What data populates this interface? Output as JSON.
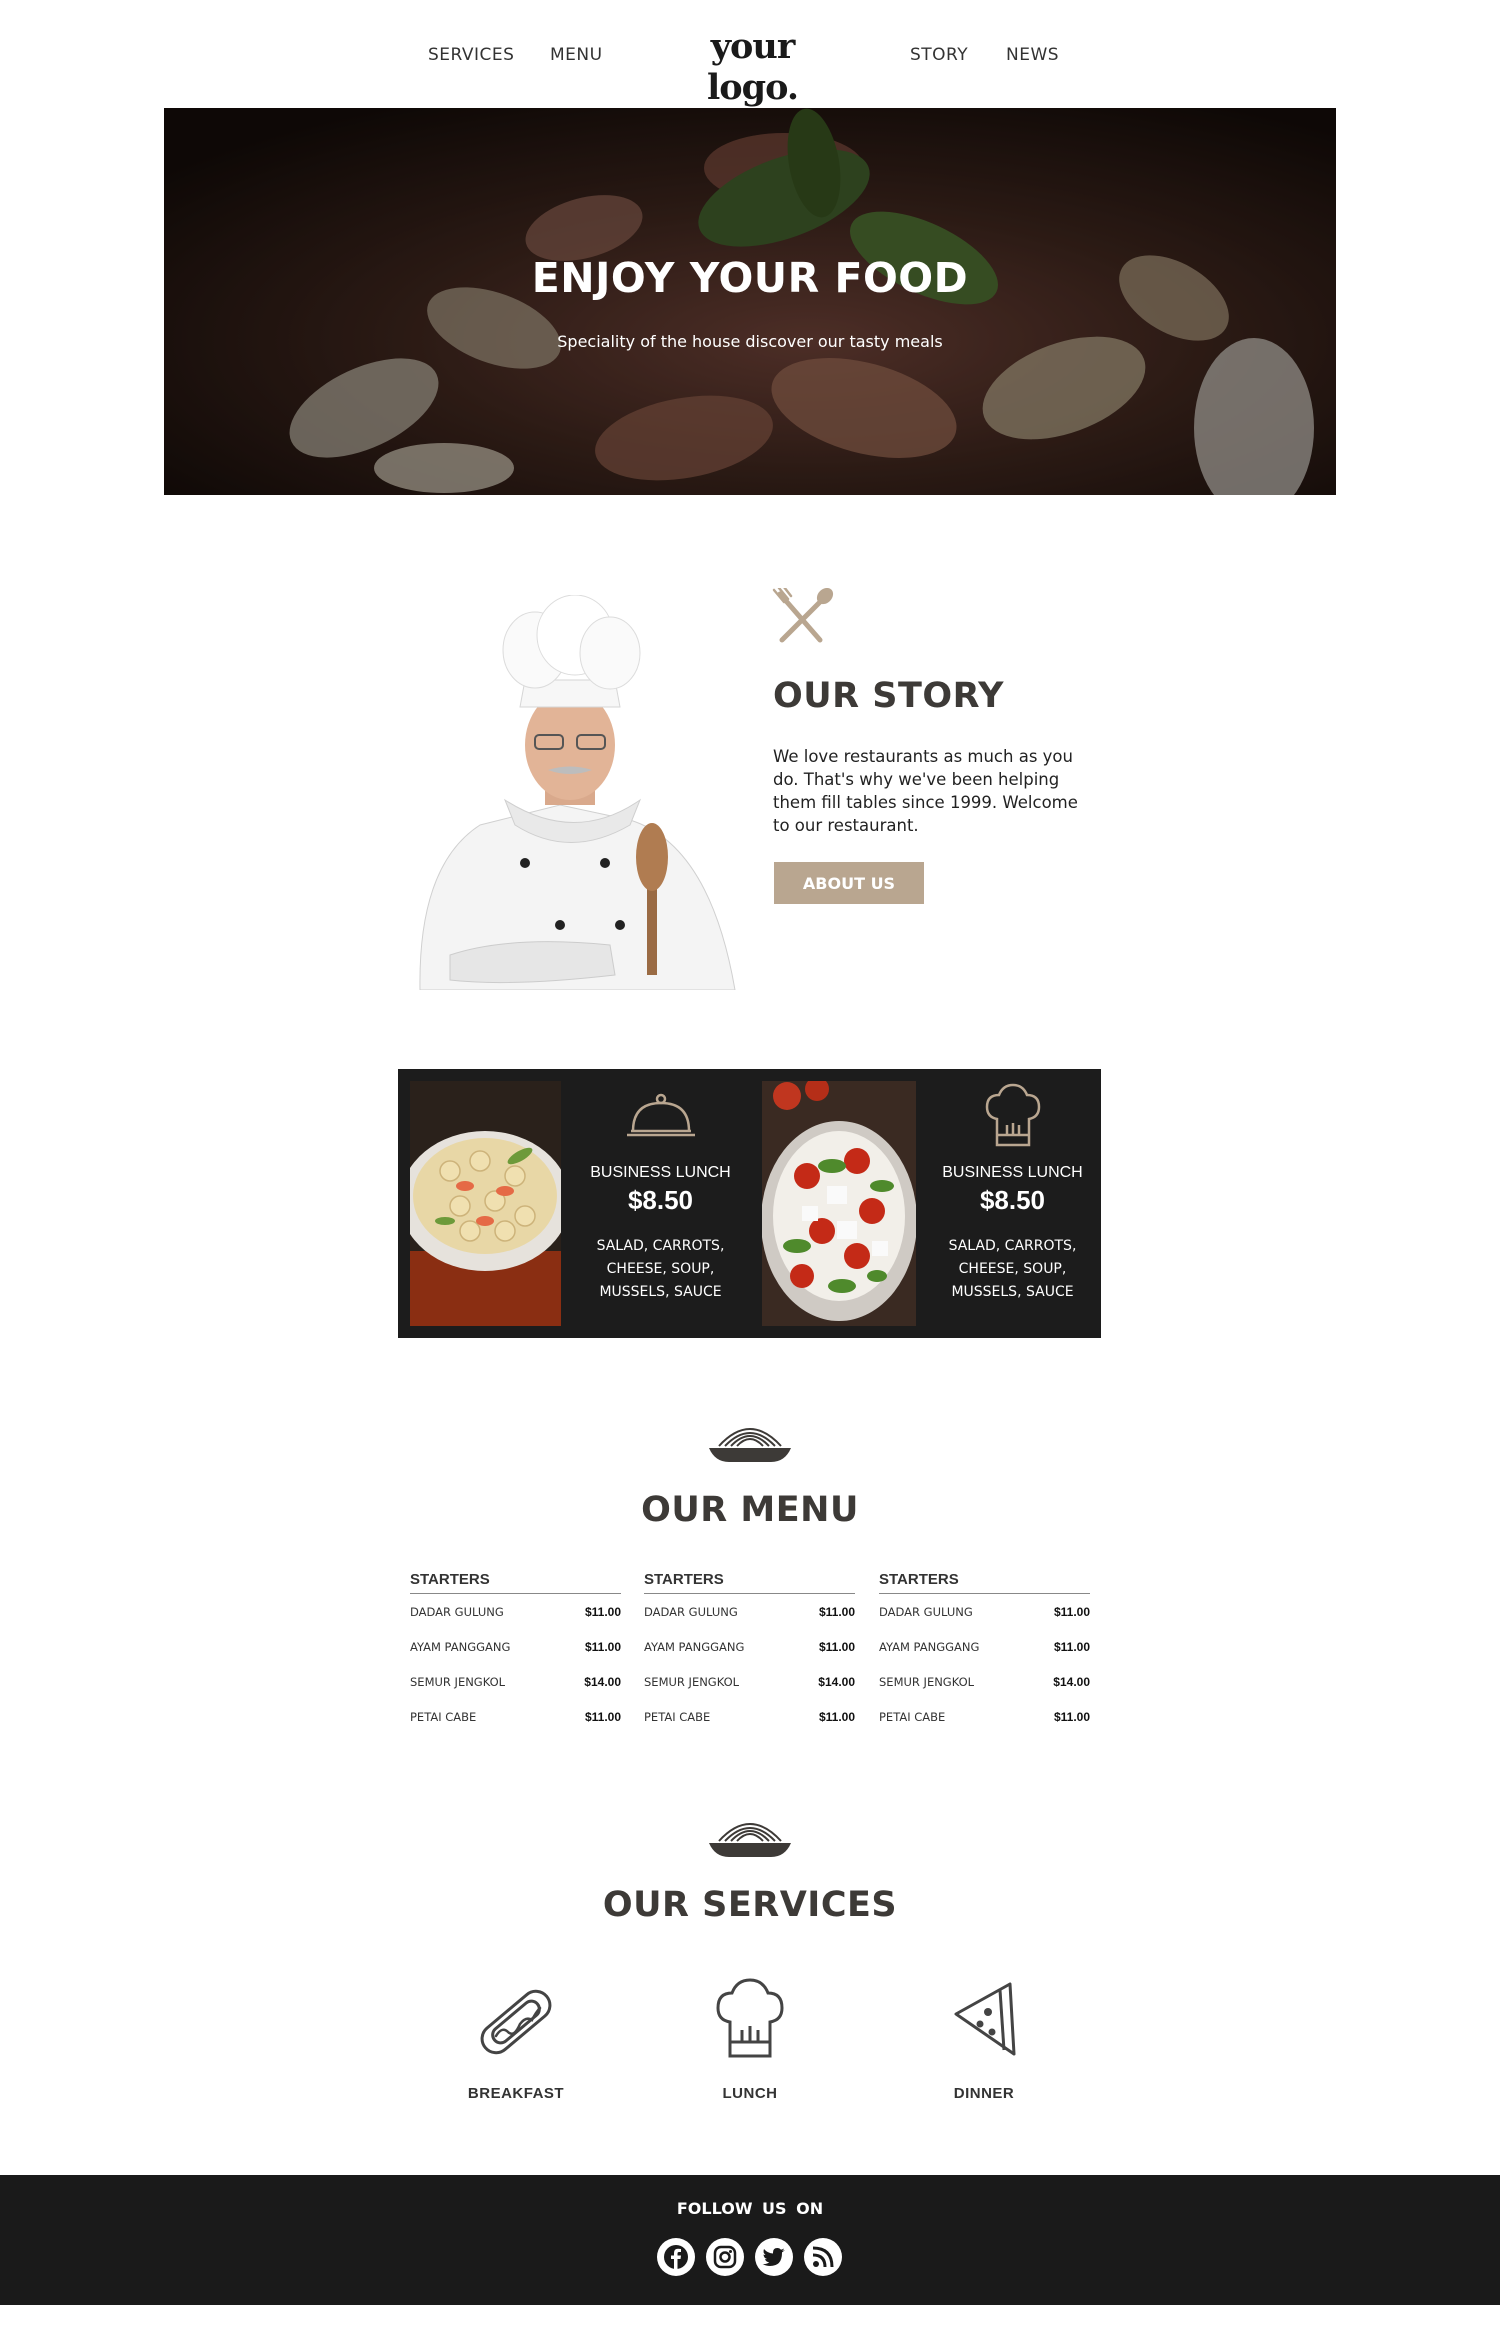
{
  "header": {
    "nav_left": [
      "SERVICES",
      "MENU"
    ],
    "logo": "your logo.",
    "nav_right": [
      "STORY",
      "NEWS"
    ]
  },
  "hero": {
    "title": "ENJOY YOUR FOOD",
    "subtitle": "Speciality of the house discover our tasty meals"
  },
  "story": {
    "title": "OUR STORY",
    "text": "We love restaurants as much as you do. That's why we've been helping them fill tables since 1999. Welcome to our restaurant.",
    "button": "ABOUT US"
  },
  "offers": [
    {
      "name": "BUSINESS LUNCH",
      "price": "$8.50",
      "desc": "SALAD, CARROTS, CHEESE, SOUP, MUSSELS, SAUCE",
      "icon": "cloche-icon"
    },
    {
      "name": "BUSINESS LUNCH",
      "price": "$8.50",
      "desc": "SALAD, CARROTS, CHEESE, SOUP, MUSSELS, SAUCE",
      "icon": "chef-hat-icon"
    }
  ],
  "menu": {
    "title": "OUR MENU",
    "columns": [
      {
        "heading": "STARTERS",
        "items": [
          {
            "name": "DADAR GULUNG",
            "price": "$11.00"
          },
          {
            "name": "AYAM PANGGANG",
            "price": "$11.00"
          },
          {
            "name": "SEMUR JENGKOL",
            "price": "$14.00"
          },
          {
            "name": "PETAI CABE",
            "price": "$11.00"
          }
        ]
      },
      {
        "heading": "STARTERS",
        "items": [
          {
            "name": "DADAR GULUNG",
            "price": "$11.00"
          },
          {
            "name": "AYAM PANGGANG",
            "price": "$11.00"
          },
          {
            "name": "SEMUR JENGKOL",
            "price": "$14.00"
          },
          {
            "name": "PETAI CABE",
            "price": "$11.00"
          }
        ]
      },
      {
        "heading": "STARTERS",
        "items": [
          {
            "name": "DADAR GULUNG",
            "price": "$11.00"
          },
          {
            "name": "AYAM PANGGANG",
            "price": "$11.00"
          },
          {
            "name": "SEMUR JENGKOL",
            "price": "$14.00"
          },
          {
            "name": "PETAI CABE",
            "price": "$11.00"
          }
        ]
      }
    ]
  },
  "services": {
    "title": "OUR SERVICES",
    "items": [
      {
        "label": "BREAKFAST",
        "icon": "hotdog-icon"
      },
      {
        "label": "LUNCH",
        "icon": "chef-hat-icon"
      },
      {
        "label": "DINNER",
        "icon": "pizza-slice-icon"
      }
    ]
  },
  "footer": {
    "follow": "FOLLOW US ON",
    "social": [
      "facebook-icon",
      "instagram-icon",
      "twitter-icon",
      "rss-icon"
    ]
  },
  "colors": {
    "accent": "#b9a690",
    "dark": "#1c1c1c",
    "heading": "#3d3a37"
  }
}
